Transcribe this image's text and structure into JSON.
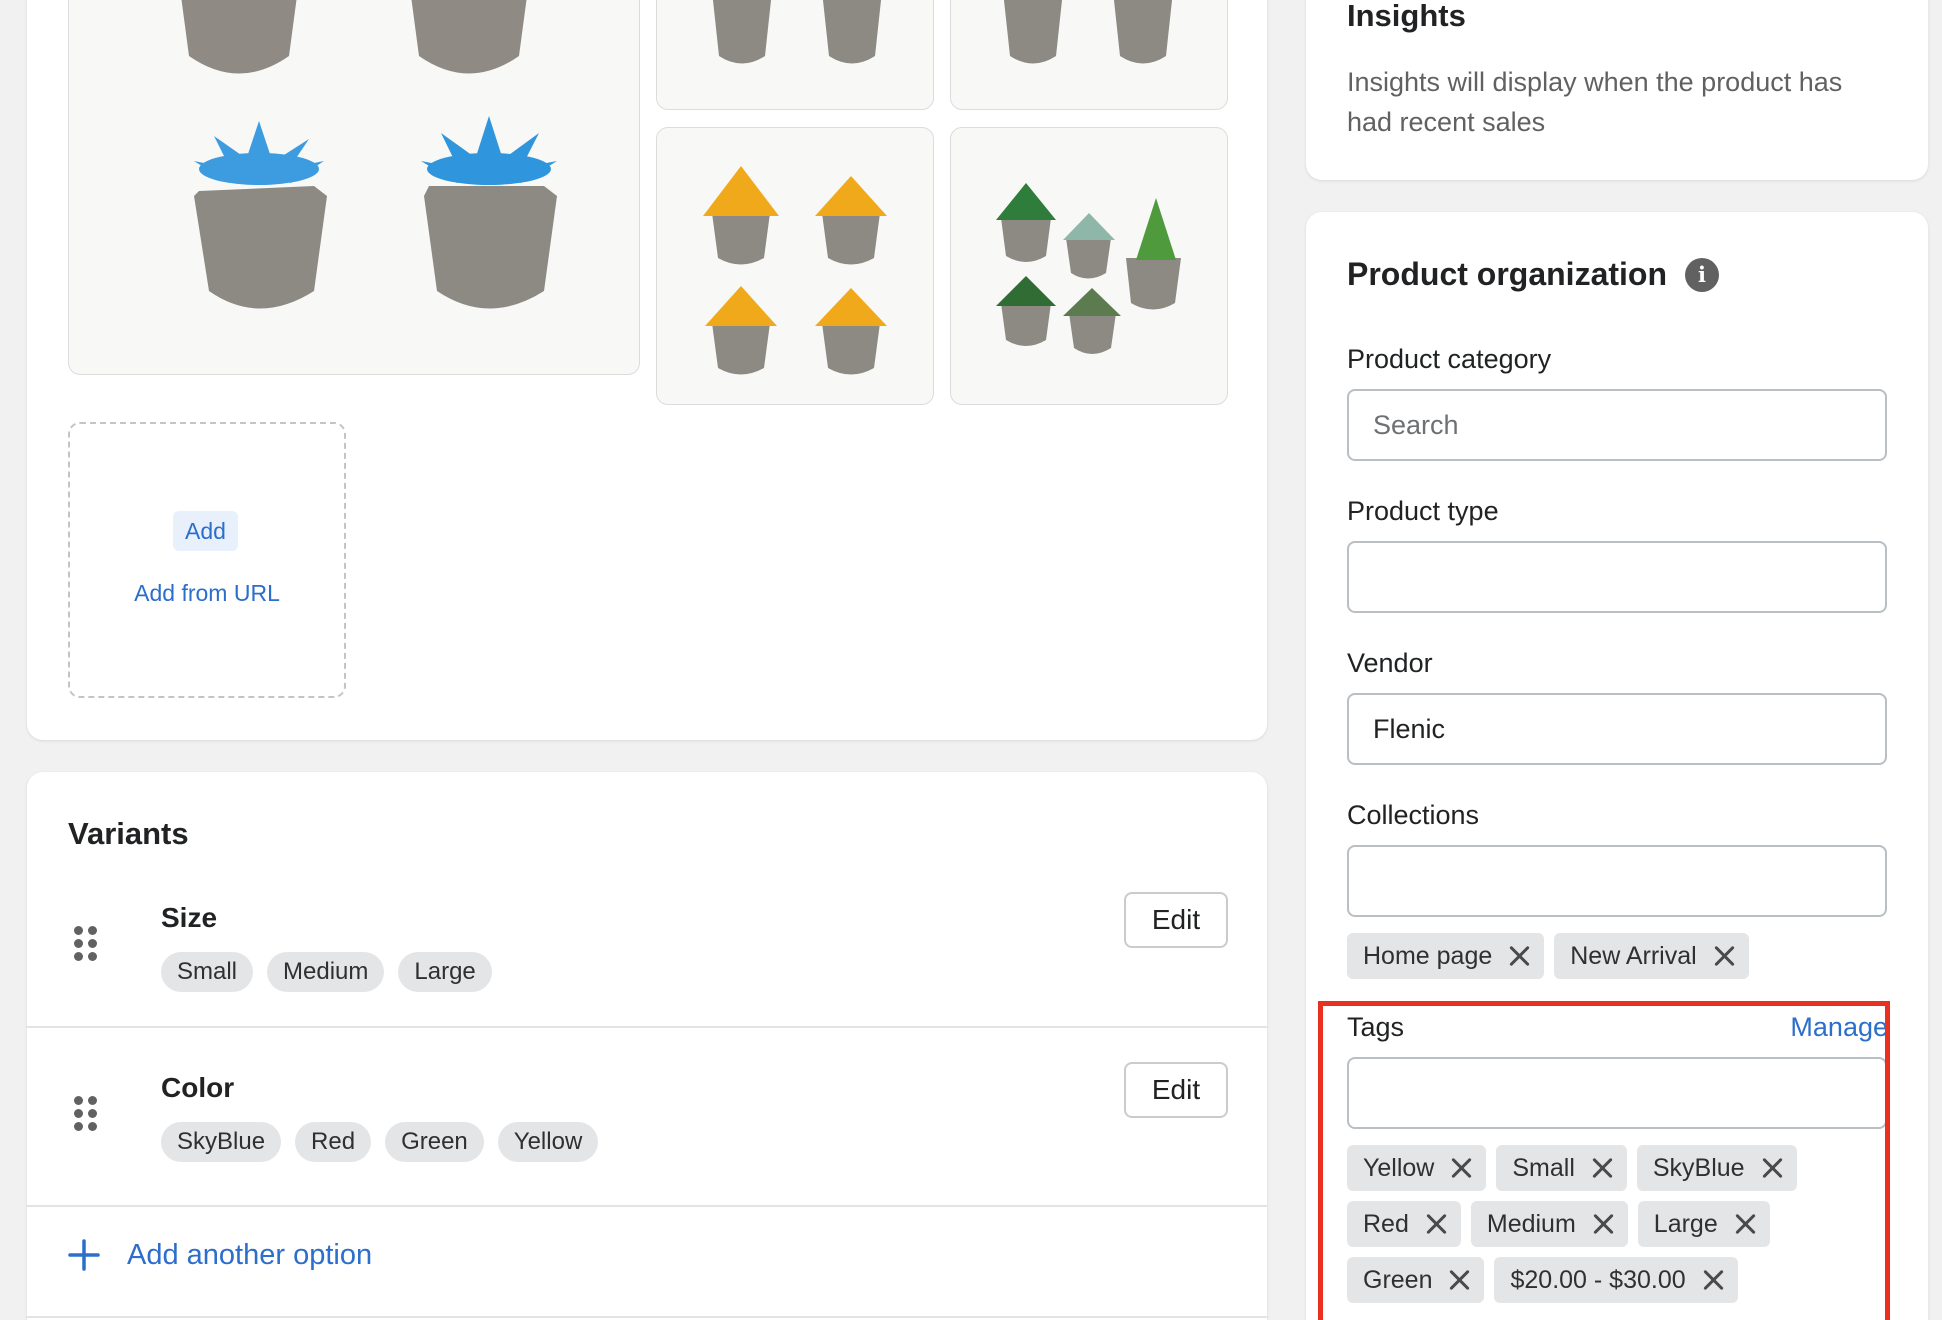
{
  "media": {
    "add_label": "Add",
    "add_from_url_label": "Add from URL"
  },
  "variants": {
    "title": "Variants",
    "edit_label": "Edit",
    "options": [
      {
        "name": "Size",
        "values": [
          "Small",
          "Medium",
          "Large"
        ]
      },
      {
        "name": "Color",
        "values": [
          "SkyBlue",
          "Red",
          "Green",
          "Yellow"
        ]
      }
    ],
    "add_another_option": "Add another option"
  },
  "insights": {
    "title": "Insights",
    "text": "Insights will display when the product has had recent sales"
  },
  "organization": {
    "title": "Product organization",
    "category": {
      "label": "Product category",
      "placeholder": "Search",
      "value": ""
    },
    "type": {
      "label": "Product type",
      "value": ""
    },
    "vendor": {
      "label": "Vendor",
      "value": "Flenic"
    },
    "collections": {
      "label": "Collections",
      "value": "",
      "chips": [
        "Home page",
        "New Arrival"
      ]
    },
    "tags": {
      "label": "Tags",
      "manage_label": "Manage",
      "value": "",
      "chips": [
        "Yellow",
        "Small",
        "SkyBlue",
        "Red",
        "Medium",
        "Large",
        "Green",
        "$20.00 - $30.00"
      ]
    }
  },
  "colors": {
    "accent": "#2c6ecb",
    "highlight": "#e8311e",
    "pot": "#8d8a84",
    "skyblue_succulent": "#3d9be0",
    "green_succulent": "#3c9a45",
    "red_succulent": "#d9252e",
    "yellow_succulent": "#f1a91c"
  }
}
